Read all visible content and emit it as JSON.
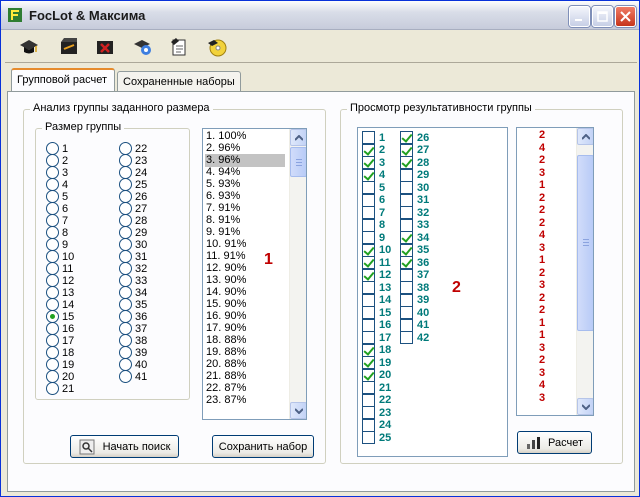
{
  "window": {
    "title": "FocLot & Максима"
  },
  "toolbar": {
    "icons": [
      "graduation-cap-icon",
      "slate-icon",
      "red-x-slate-icon",
      "gear-cap-icon",
      "notebook-icon",
      "cd-icon"
    ]
  },
  "tabs": [
    {
      "label": "Групповой расчет",
      "active": true
    },
    {
      "label": "Сохраненные наборы",
      "active": false
    }
  ],
  "left_group": {
    "title": "Анализ группы заданного размера",
    "size_group_title": "Размер группы",
    "sizes_col1": [
      "1",
      "2",
      "3",
      "4",
      "5",
      "6",
      "7",
      "8",
      "9",
      "10",
      "11",
      "12",
      "13",
      "14",
      "15",
      "16",
      "17",
      "18",
      "19",
      "20",
      "21"
    ],
    "sizes_col2": [
      "22",
      "23",
      "24",
      "25",
      "26",
      "27",
      "28",
      "29",
      "30",
      "31",
      "32",
      "33",
      "34",
      "35",
      "36",
      "37",
      "38",
      "39",
      "40",
      "41"
    ],
    "selected_size": "15",
    "ranking": [
      "1. 100%",
      "2. 96%",
      "3. 96%",
      "4. 94%",
      "5. 93%",
      "6. 93%",
      "7. 91%",
      "8. 91%",
      "9. 91%",
      "10. 91%",
      "11. 91%",
      "12. 90%",
      "13. 90%",
      "14. 90%",
      "15. 90%",
      "16. 90%",
      "17. 90%",
      "18. 88%",
      "19. 88%",
      "20. 88%",
      "21. 88%",
      "22. 87%",
      "23. 87%"
    ],
    "selected_rank_index": 2,
    "marker": "1",
    "search_button": "Начать поиск",
    "save_button": "Сохранить набор"
  },
  "right_group": {
    "title": "Просмотр результативности группы",
    "col1": [
      {
        "n": "1",
        "c": false
      },
      {
        "n": "2",
        "c": true
      },
      {
        "n": "3",
        "c": true
      },
      {
        "n": "4",
        "c": true
      },
      {
        "n": "5",
        "c": false
      },
      {
        "n": "6",
        "c": false
      },
      {
        "n": "7",
        "c": false
      },
      {
        "n": "8",
        "c": false
      },
      {
        "n": "9",
        "c": false
      },
      {
        "n": "10",
        "c": true
      },
      {
        "n": "11",
        "c": true
      },
      {
        "n": "12",
        "c": true
      },
      {
        "n": "13",
        "c": false
      },
      {
        "n": "14",
        "c": false
      },
      {
        "n": "15",
        "c": false
      },
      {
        "n": "16",
        "c": false
      },
      {
        "n": "17",
        "c": false
      },
      {
        "n": "18",
        "c": true
      },
      {
        "n": "19",
        "c": true
      },
      {
        "n": "20",
        "c": true
      },
      {
        "n": "21",
        "c": false
      },
      {
        "n": "22",
        "c": false
      },
      {
        "n": "23",
        "c": false
      },
      {
        "n": "24",
        "c": false
      },
      {
        "n": "25",
        "c": false
      }
    ],
    "col2": [
      {
        "n": "26",
        "c": true
      },
      {
        "n": "27",
        "c": true
      },
      {
        "n": "28",
        "c": true
      },
      {
        "n": "29",
        "c": false
      },
      {
        "n": "30",
        "c": false
      },
      {
        "n": "31",
        "c": false
      },
      {
        "n": "32",
        "c": false
      },
      {
        "n": "33",
        "c": false
      },
      {
        "n": "34",
        "c": true
      },
      {
        "n": "35",
        "c": true
      },
      {
        "n": "36",
        "c": true
      },
      {
        "n": "37",
        "c": false
      },
      {
        "n": "38",
        "c": false
      },
      {
        "n": "39",
        "c": false
      },
      {
        "n": "40",
        "c": false
      },
      {
        "n": "41",
        "c": false
      },
      {
        "n": "42",
        "c": false
      }
    ],
    "results": [
      "2",
      "4",
      "2",
      "3",
      "1",
      "2",
      "2",
      "2",
      "4",
      "3",
      "1",
      "2",
      "3",
      "2",
      "2",
      "1",
      "1",
      "3",
      "2",
      "3",
      "4",
      "3"
    ],
    "marker": "2",
    "calc_button": "Расчет"
  },
  "colors": {
    "teal": "#007a7a",
    "red": "#c00000",
    "green_check": "#21a121"
  }
}
